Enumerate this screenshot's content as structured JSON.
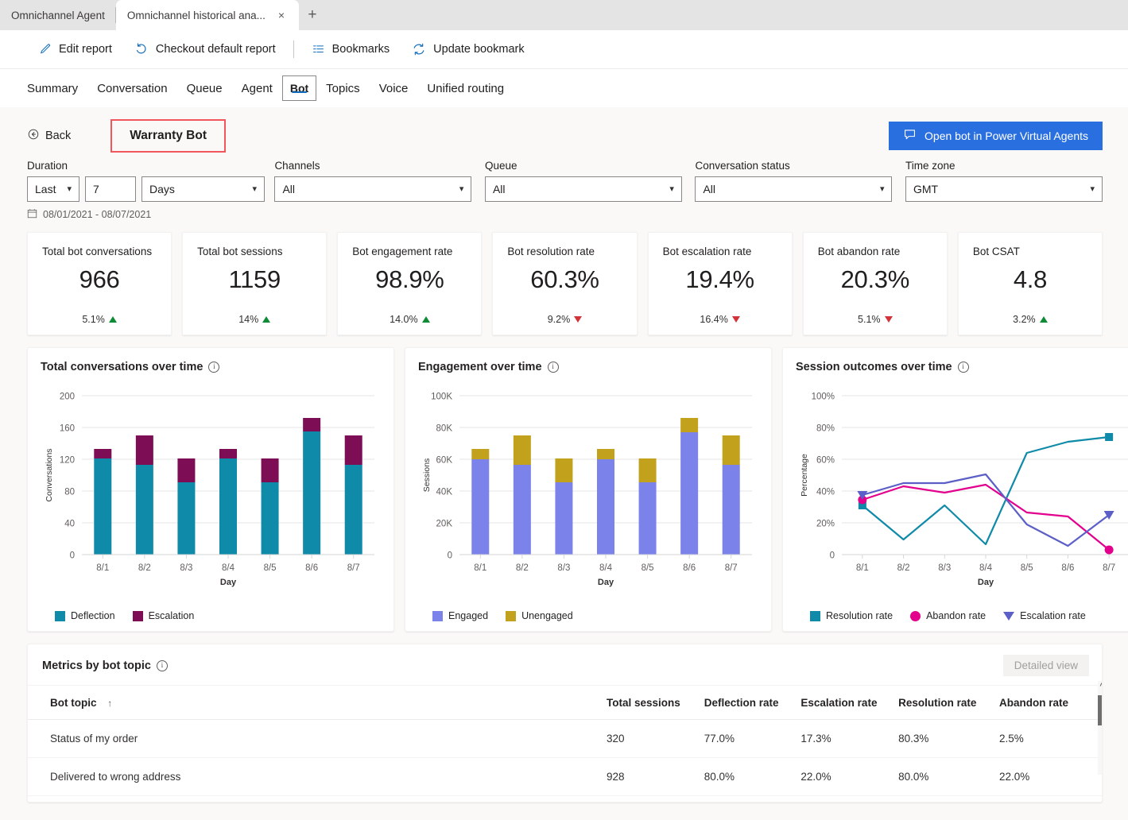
{
  "browser": {
    "tabs": [
      {
        "title": "Omnichannel Agent",
        "active": false
      },
      {
        "title": "Omnichannel historical ana...",
        "active": true
      }
    ],
    "close_icon": "×",
    "newtab_icon": "+"
  },
  "commandbar": {
    "items": [
      {
        "label": "Edit report",
        "icon": "pencil-icon"
      },
      {
        "label": "Checkout default report",
        "icon": "undo-icon"
      },
      {
        "label": "Bookmarks",
        "icon": "bookmarks-list-icon"
      },
      {
        "label": "Update bookmark",
        "icon": "refresh-icon"
      }
    ]
  },
  "navtabs": [
    {
      "label": "Summary",
      "selected": false
    },
    {
      "label": "Conversation",
      "selected": false
    },
    {
      "label": "Queue",
      "selected": false
    },
    {
      "label": "Agent",
      "selected": false
    },
    {
      "label": "Bot",
      "selected": true
    },
    {
      "label": "Topics",
      "selected": false
    },
    {
      "label": "Voice",
      "selected": false
    },
    {
      "label": "Unified routing",
      "selected": false
    }
  ],
  "header": {
    "back_label": "Back",
    "bot_name": "Warranty Bot",
    "highlight_color": "#f1565c",
    "open_bot_button": "Open bot in Power Virtual Agents",
    "open_bot_button_color": "#2a6fe0"
  },
  "filters": {
    "duration": {
      "label": "Duration",
      "mode": "Last",
      "amount": "7",
      "unit": "Days"
    },
    "channels": {
      "label": "Channels",
      "value": "All"
    },
    "queue": {
      "label": "Queue",
      "value": "All"
    },
    "conversation_status": {
      "label": "Conversation status",
      "value": "All"
    },
    "time_zone": {
      "label": "Time zone",
      "value": "GMT"
    },
    "date_range": "08/01/2021 - 08/07/2021"
  },
  "kpis": [
    {
      "name": "Total bot conversations",
      "value": "966",
      "delta": "5.1%",
      "dir": "up"
    },
    {
      "name": "Total bot sessions",
      "value": "1159",
      "delta": "14%",
      "dir": "up"
    },
    {
      "name": "Bot engagement rate",
      "value": "98.9%",
      "delta": "14.0%",
      "dir": "up"
    },
    {
      "name": "Bot resolution rate",
      "value": "60.3%",
      "delta": "9.2%",
      "dir": "down"
    },
    {
      "name": "Bot escalation rate",
      "value": "19.4%",
      "delta": "16.4%",
      "dir": "down"
    },
    {
      "name": "Bot abandon rate",
      "value": "20.3%",
      "delta": "5.1%",
      "dir": "down"
    },
    {
      "name": "Bot CSAT",
      "value": "4.8",
      "delta": "3.2%",
      "dir": "up"
    }
  ],
  "chart_data": [
    {
      "type": "bar",
      "stacked": true,
      "title": "Total conversations over time",
      "xlabel": "Day",
      "ylabel": "Conversations",
      "categories": [
        "8/1",
        "8/2",
        "8/3",
        "8/4",
        "8/5",
        "8/6",
        "8/7"
      ],
      "ylim": [
        0,
        200
      ],
      "yticks": [
        0,
        40,
        80,
        120,
        160,
        200
      ],
      "grid": true,
      "legend_position": "bottom",
      "series": [
        {
          "name": "Deflection",
          "color": "#0f8aa8",
          "values": [
            121,
            113,
            91,
            121,
            91,
            155,
            113
          ]
        },
        {
          "name": "Escalation",
          "color": "#7d0d55",
          "values": [
            12,
            37,
            30,
            12,
            30,
            17,
            37
          ]
        }
      ]
    },
    {
      "type": "bar",
      "stacked": true,
      "title": "Engagement over time",
      "xlabel": "Day",
      "ylabel": "Sessions",
      "categories": [
        "8/1",
        "8/2",
        "8/3",
        "8/4",
        "8/5",
        "8/6",
        "8/7"
      ],
      "ylim": [
        0,
        100000
      ],
      "yticks": [
        0,
        20000,
        40000,
        60000,
        80000,
        100000
      ],
      "ytick_labels": [
        "0",
        "20K",
        "40K",
        "60K",
        "80K",
        "100K"
      ],
      "grid": true,
      "legend_position": "bottom",
      "series": [
        {
          "name": "Engaged",
          "color": "#7b83eb",
          "values": [
            60000,
            56500,
            45500,
            60000,
            45500,
            77000,
            56500
          ]
        },
        {
          "name": "Unengaged",
          "color": "#c2a21c",
          "values": [
            6500,
            18500,
            15000,
            6500,
            15000,
            9000,
            18500
          ]
        }
      ]
    },
    {
      "type": "line",
      "title": "Session outcomes over time",
      "xlabel": "Day",
      "ylabel": "Percentage",
      "categories": [
        "8/1",
        "8/2",
        "8/3",
        "8/4",
        "8/5",
        "8/6",
        "8/7"
      ],
      "ylim": [
        0,
        100
      ],
      "yticks": [
        0,
        20,
        40,
        60,
        80,
        100
      ],
      "ytick_labels": [
        "0",
        "20%",
        "40%",
        "60%",
        "80%",
        "100%"
      ],
      "grid": true,
      "legend_position": "bottom",
      "series": [
        {
          "name": "Resolution rate",
          "color": "#0f8aa8",
          "marker": "square",
          "values": [
            31,
            9.5,
            31,
            6.5,
            64,
            71,
            74
          ]
        },
        {
          "name": "Abandon rate",
          "color": "#e3008c",
          "marker": "circle",
          "values": [
            34.5,
            43,
            39,
            44,
            26.5,
            24,
            3
          ]
        },
        {
          "name": "Escalation rate",
          "color": "#5b5fc7",
          "marker": "triangle",
          "values": [
            37.5,
            45,
            45,
            50.5,
            19,
            5.5,
            25
          ]
        }
      ]
    }
  ],
  "table": {
    "title": "Metrics by bot topic",
    "detailed_view_label": "Detailed view",
    "sort_column": "Bot topic",
    "sort_icon": "↑",
    "columns": [
      "Bot topic",
      "Total sessions",
      "Deflection rate",
      "Escalation rate",
      "Resolution rate",
      "Abandon rate"
    ],
    "rows": [
      {
        "topic": "Status of my order",
        "total_sessions": "320",
        "deflection_rate": "77.0%",
        "escalation_rate": "17.3%",
        "resolution_rate": "80.3%",
        "abandon_rate": "2.5%"
      },
      {
        "topic": "Delivered to wrong address",
        "total_sessions": "928",
        "deflection_rate": "80.0%",
        "escalation_rate": "22.0%",
        "resolution_rate": "80.0%",
        "abandon_rate": "22.0%"
      }
    ]
  }
}
